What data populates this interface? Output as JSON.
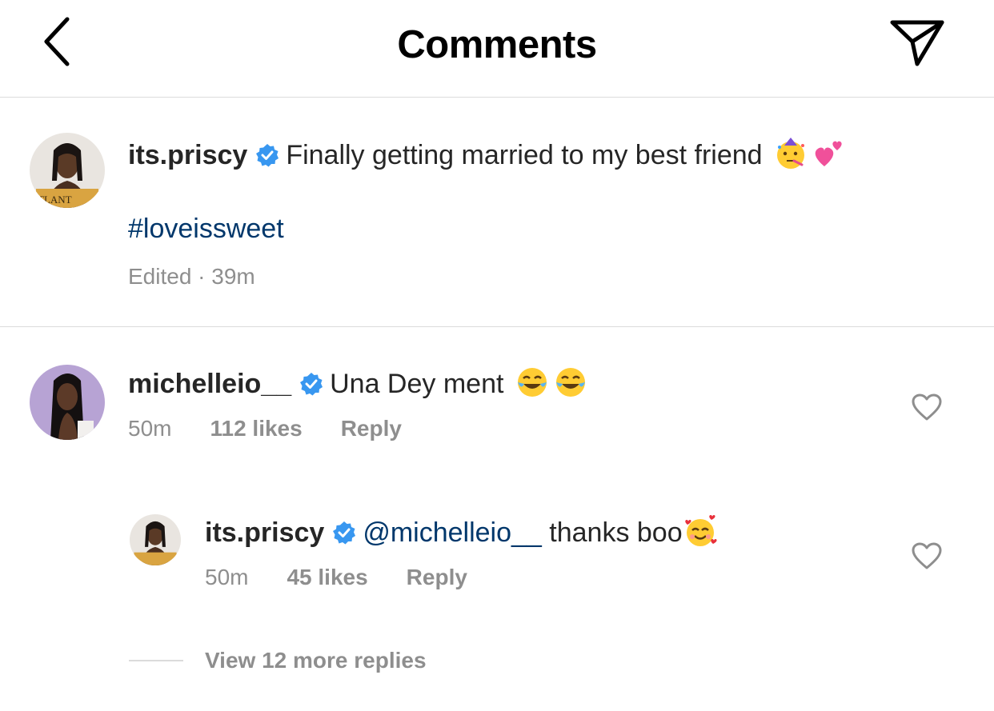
{
  "header": {
    "title": "Comments",
    "back_icon": "chevron-left-icon",
    "share_icon": "paper-plane-icon"
  },
  "caption": {
    "username": "its.priscy",
    "text": "Finally getting married to my best friend",
    "emojis": [
      "partying-face-emoji",
      "two-hearts-emoji"
    ],
    "hashtag": "#loveissweet",
    "meta": "Edited · 39m"
  },
  "comments": [
    {
      "username": "michelleio__",
      "text": "Una Dey ment",
      "emojis": [
        "tears-of-joy-emoji",
        "tears-of-joy-emoji"
      ],
      "time": "50m",
      "likes": "112 likes",
      "reply": "Reply"
    }
  ],
  "replies": [
    {
      "username": "its.priscy",
      "mention": "@michelleio__",
      "text": "thanks boo",
      "emojis": [
        "smiling-face-with-hearts-emoji"
      ],
      "time": "50m",
      "likes": "45 likes",
      "reply": "Reply"
    }
  ],
  "view_more": "View 12 more replies",
  "colors": {
    "verified_blue": "#3897f0",
    "link_blue": "#00376b",
    "meta_gray": "#8e8e8e",
    "divider": "#dbdbdb"
  }
}
